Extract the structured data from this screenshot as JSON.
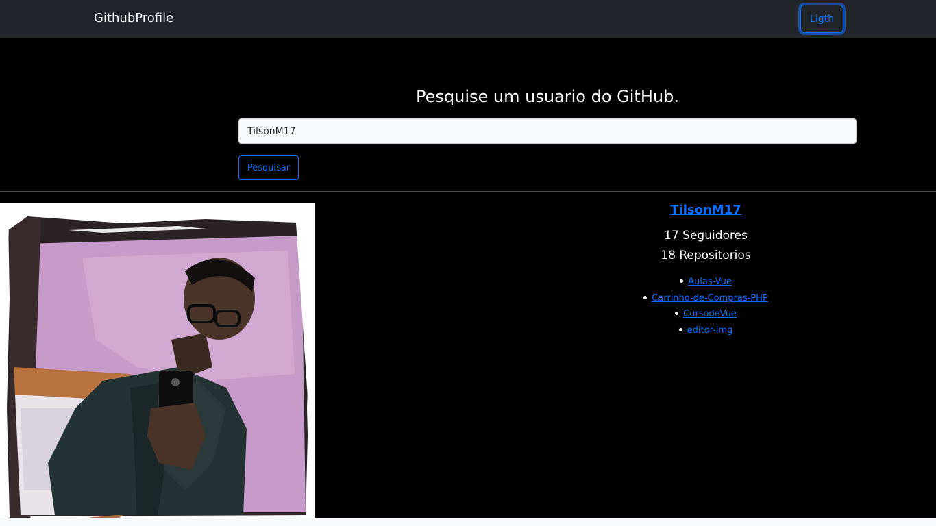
{
  "navbar": {
    "brand": "GithubProfile",
    "theme_button": "Ligth"
  },
  "search": {
    "title": "Pesquise um usuario do GitHub.",
    "input_value": "TilsonM17",
    "button_label": "Pesquisar"
  },
  "profile": {
    "username": "TilsonM17",
    "followers": "17 Seguidores",
    "repositories": "18 Repositorios",
    "repos": [
      "Aulas-Vue",
      "Carrinho-de-Compras-PHP",
      "CursodeVue",
      "editor-img"
    ],
    "avatar_icon": "user-avatar-photo"
  },
  "colors": {
    "navbar_bg": "#212529",
    "page_bg": "#000000",
    "accent": "#0d6efd"
  }
}
